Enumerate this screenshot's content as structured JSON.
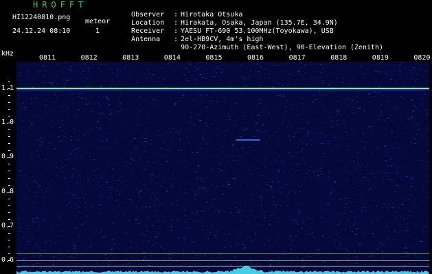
{
  "header": {
    "brand": "HROFFT",
    "filename": "HI12240810.png",
    "datetime": "24.12.24 08:10",
    "meteor_label": "meteor",
    "meteor_count": "1"
  },
  "station": [
    {
      "key": "Observer",
      "value": "Hirotaka Otsuka"
    },
    {
      "key": "Location",
      "value": "Hirakata, Osaka, Japan (135.7E, 34.9N)"
    },
    {
      "key": "Receiver",
      "value": "YAESU FT-690 53.100MHz(Toyokawa), USB"
    },
    {
      "key": "Antenna",
      "value": "2el-HB9CV, 4m's high"
    },
    {
      "key": "",
      "value": "90-270-Azimuth (East-West), 90-Elevation (Zenith)"
    }
  ],
  "chart_data": {
    "type": "heatmap",
    "ylabel": "kHz",
    "x_ticks": [
      "0811",
      "0812",
      "0813",
      "0814",
      "0815",
      "0816",
      "0817",
      "0818",
      "0819",
      "0820"
    ],
    "y_ticks": [
      "1.1",
      "1.0",
      "0.9",
      "0.8",
      "0.7",
      "0.6"
    ],
    "ylim": [
      0.6,
      1.15
    ],
    "carrier_khz": 1.1,
    "meteor_echo": {
      "time": "0816",
      "khz": 0.95
    },
    "colors": {
      "background": "#05083a",
      "carrier": "#9be28a",
      "echo": "#2d7fe6",
      "spectrum": "#3fd0e6"
    }
  }
}
